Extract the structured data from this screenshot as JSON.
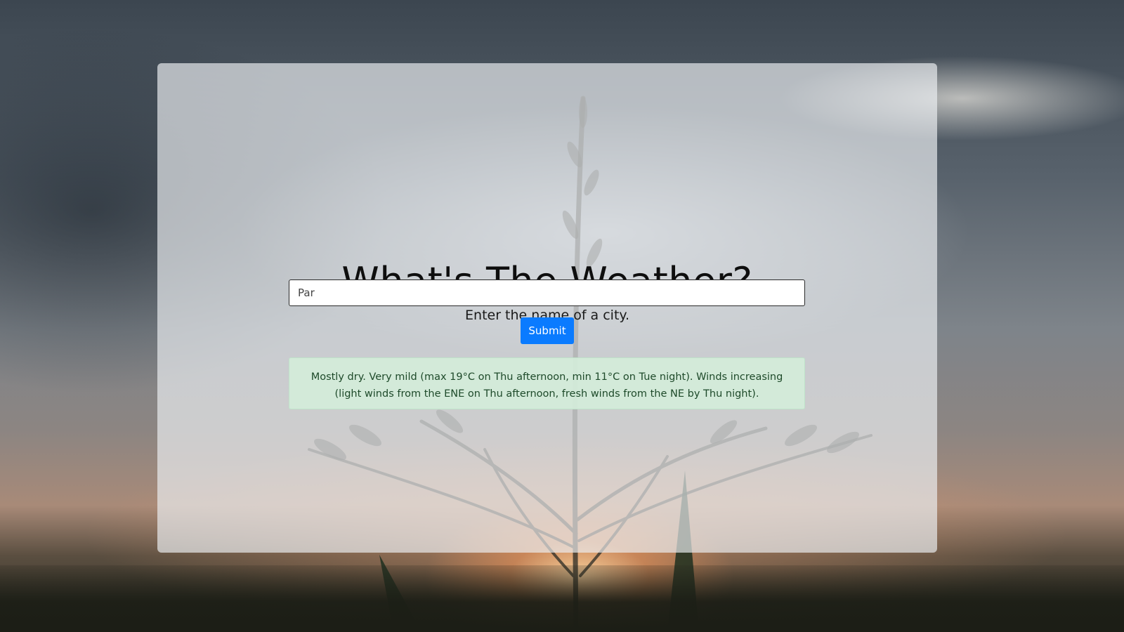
{
  "page": {
    "title": "What's The Weather?",
    "subtitle": "Enter the name of a city."
  },
  "search": {
    "value": "Par",
    "placeholder": ""
  },
  "submit": {
    "label": "Submit"
  },
  "forecast": {
    "message": "Mostly dry. Very mild (max 19°C on Thu afternoon, min 11°C on Tue night). Winds increasing (light winds from the ENE on Thu afternoon, fresh winds from the NE by Thu night)."
  },
  "colors": {
    "button": "#0a7bff",
    "alert_background": "#d4edda",
    "alert_text": "#1e4a2a"
  }
}
